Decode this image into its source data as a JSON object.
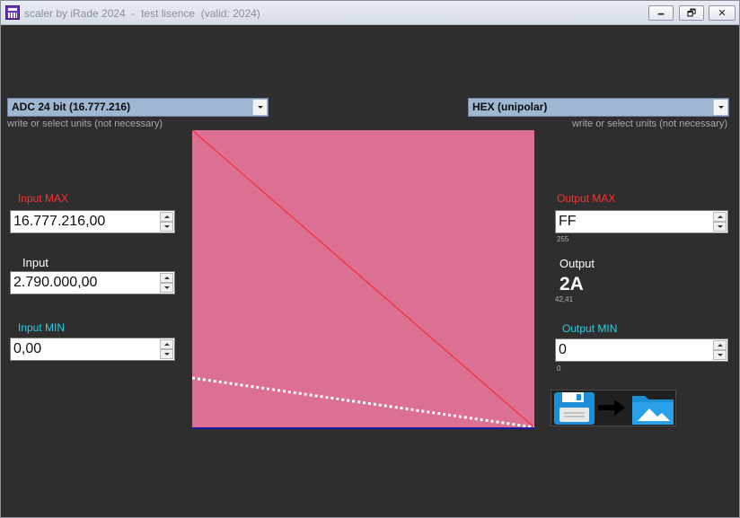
{
  "window": {
    "title": "scaler by iRade 2024  -  test lisence  (valid: 2024)",
    "buttons": {
      "minimize": "🗕",
      "maximize": "🗗",
      "close": "✕"
    }
  },
  "left": {
    "source_select": "ADC 24 bit  (16.777.216)",
    "units_hint": "write or select units (not necessary)",
    "input_max_label": "Input MAX",
    "input_max_value": "16.777.216,00",
    "input_label": "Input",
    "input_value": "2.790.000,00",
    "input_min_label": "Input MIN",
    "input_min_value": "0,00"
  },
  "right": {
    "target_select": "HEX (unipolar)",
    "units_hint": "write or select units (not necessary)",
    "output_max_label": "Output MAX",
    "output_max_value": "FF",
    "output_max_decimal": "255",
    "output_label": "Output",
    "output_value": "2A",
    "output_decimal": "42,41",
    "output_min_label": "Output MIN",
    "output_min_value": "0",
    "output_min_decimal": "0"
  },
  "graph": {
    "background": "#dc7092",
    "line_color": "#ff2020",
    "input_fraction": 0.1663
  },
  "icons": {
    "save": "floppy-disk-icon",
    "arrow": "arrow-right-icon",
    "folder": "folder-icon"
  },
  "colors": {
    "window_bg": "#2e2e2e",
    "max_label": "#ff3131",
    "min_label": "#29d0e8",
    "combo_bg": "#9fb7d3"
  }
}
